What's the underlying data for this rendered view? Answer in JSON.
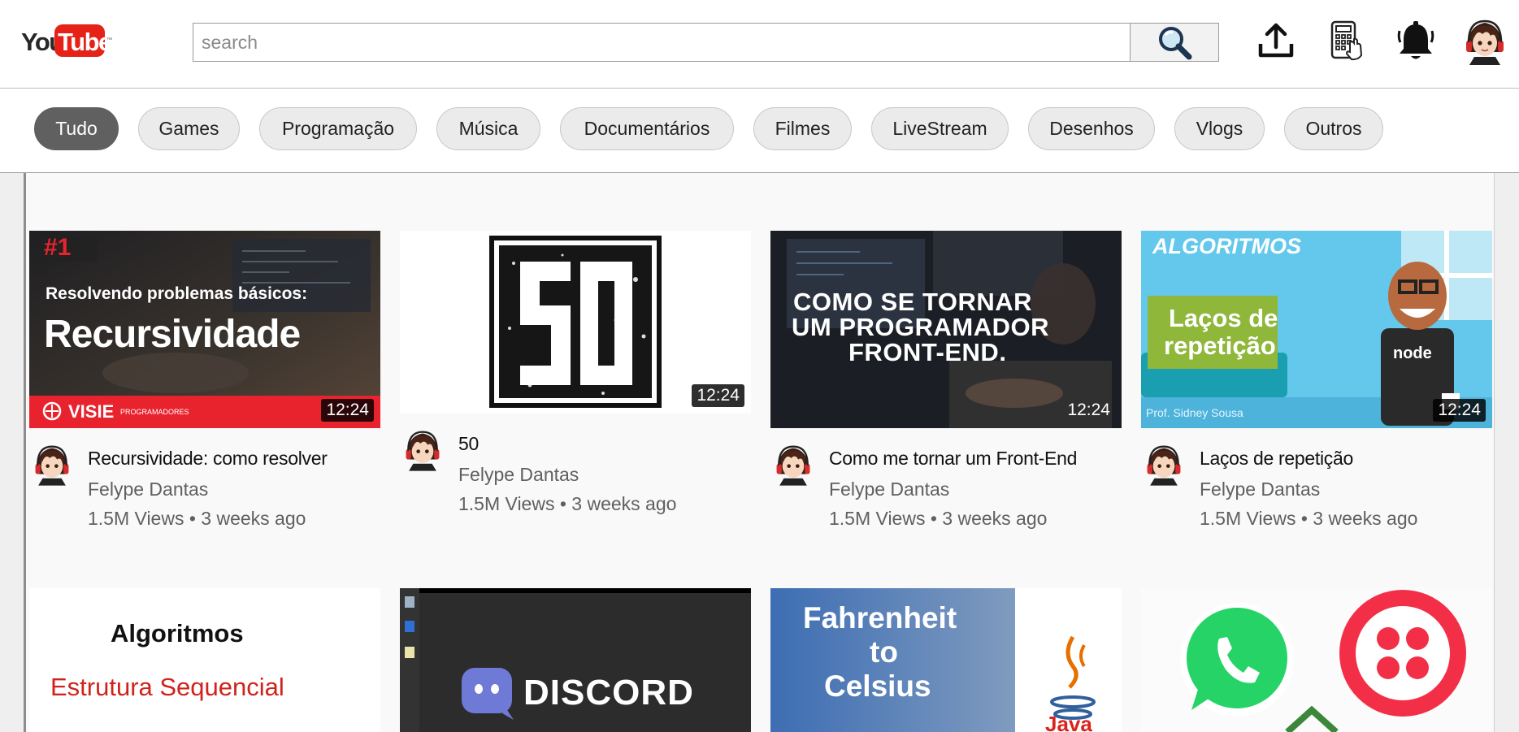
{
  "header": {
    "logo_you": "You",
    "logo_tube": "Tube",
    "logo_tm": "™",
    "search_placeholder": "search",
    "icons": [
      "search-icon",
      "upload-icon",
      "apps-icon",
      "notifications-bell-icon",
      "user-avatar"
    ]
  },
  "chips": [
    {
      "label": "Tudo",
      "active": true
    },
    {
      "label": "Games"
    },
    {
      "label": "Programação"
    },
    {
      "label": "Música"
    },
    {
      "label": "Documentários"
    },
    {
      "label": "Filmes"
    },
    {
      "label": "LiveStream"
    },
    {
      "label": "Desenhos"
    },
    {
      "label": "Vlogs"
    },
    {
      "label": "Outros"
    }
  ],
  "videos": [
    {
      "title": "Recursividade: como resolver",
      "channel": "Felype Dantas",
      "meta": "1.5M Views • 3 weeks ago",
      "duration": "12:24",
      "thumb": {
        "badge": "#1",
        "line1": "Resolvendo problemas básicos:",
        "line2": "Recursividade",
        "brand": "VISIE",
        "brand_sub": "PROGRAMADORES"
      }
    },
    {
      "title": "50",
      "channel": "Felype Dantas",
      "meta": "1.5M Views • 3 weeks ago",
      "duration": "12:24",
      "thumb": {
        "text": "50"
      }
    },
    {
      "title": "Como me tornar um Front-End",
      "channel": "Felype Dantas",
      "meta": "1.5M Views • 3 weeks ago",
      "duration": "12:24",
      "thumb": {
        "line1": "COMO SE TORNAR",
        "line2": "UM PROGRAMADOR",
        "line3": "FRONT-END."
      }
    },
    {
      "title": "Laços de repetição",
      "channel": "Felype Dantas",
      "meta": "1.5M Views • 3 weeks ago",
      "duration": "12:24",
      "thumb": {
        "heading": "ALGORITMOS",
        "line1": "Laços de",
        "line2": "repetição",
        "shirt": "node",
        "credit": "Prof. Sidney Sousa"
      }
    }
  ],
  "videos_row2": [
    {
      "thumb": {
        "line1": "Algoritmos",
        "line2": "Estrutura Sequencial"
      }
    },
    {
      "thumb": {
        "text": "DISCORD"
      }
    },
    {
      "thumb": {
        "line1": "Fahrenheit",
        "line2": "to",
        "line3": "Celsius",
        "side": "Java"
      }
    },
    {
      "thumb": {
        "desc": ""
      }
    }
  ],
  "colors": {
    "brand_red": "#e62117",
    "chip_active": "#606060",
    "chip_bg": "#ebebeb",
    "muted_text": "#606060"
  }
}
